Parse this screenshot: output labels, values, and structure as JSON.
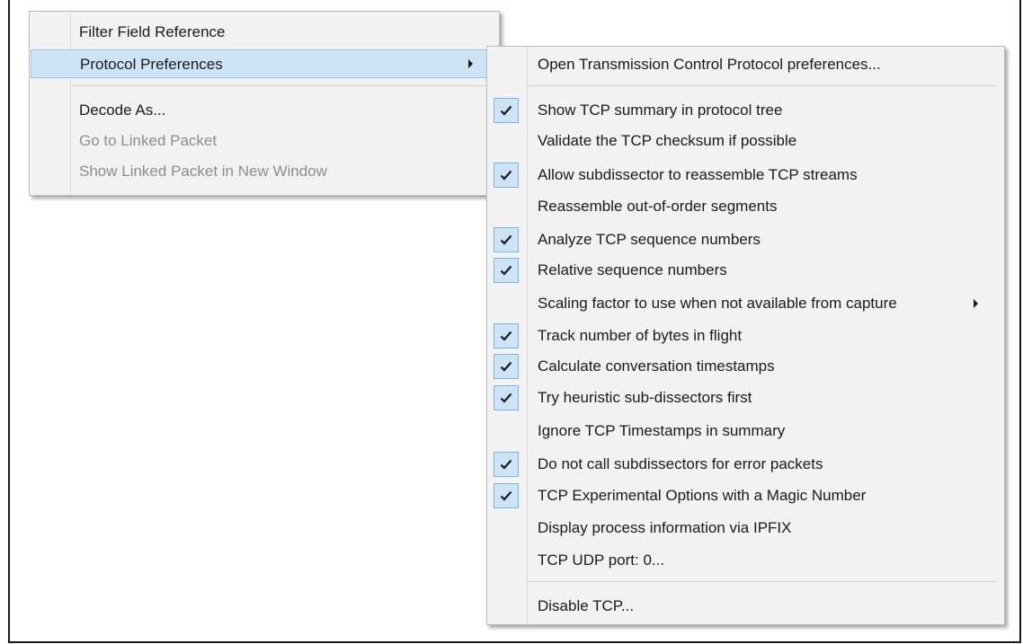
{
  "left_menu": {
    "items": [
      {
        "label": "Filter Field Reference",
        "enabled": true,
        "highlighted": false,
        "submenu": false
      },
      {
        "label": "Protocol Preferences",
        "enabled": true,
        "highlighted": true,
        "submenu": true
      },
      {
        "label": "Decode As...",
        "enabled": true,
        "highlighted": false,
        "submenu": false
      },
      {
        "label": "Go to Linked Packet",
        "enabled": false,
        "highlighted": false,
        "submenu": false
      },
      {
        "label": "Show Linked Packet in New Window",
        "enabled": false,
        "highlighted": false,
        "submenu": false
      }
    ]
  },
  "submenu": {
    "items": [
      {
        "label": "Open Transmission Control Protocol preferences...",
        "checked": false,
        "submenu": false
      },
      {
        "label": "Show TCP summary in protocol tree",
        "checked": true,
        "submenu": false
      },
      {
        "label": "Validate the TCP checksum if possible",
        "checked": false,
        "submenu": false
      },
      {
        "label": "Allow subdissector to reassemble TCP streams",
        "checked": true,
        "submenu": false
      },
      {
        "label": "Reassemble out-of-order segments",
        "checked": false,
        "submenu": false
      },
      {
        "label": "Analyze TCP sequence numbers",
        "checked": true,
        "submenu": false
      },
      {
        "label": "Relative sequence numbers",
        "checked": true,
        "submenu": false
      },
      {
        "label": "Scaling factor to use when not available from capture",
        "checked": false,
        "submenu": true
      },
      {
        "label": "Track number of bytes in flight",
        "checked": true,
        "submenu": false
      },
      {
        "label": "Calculate conversation timestamps",
        "checked": true,
        "submenu": false
      },
      {
        "label": "Try heuristic sub-dissectors first",
        "checked": true,
        "submenu": false
      },
      {
        "label": "Ignore TCP Timestamps in summary",
        "checked": false,
        "submenu": false
      },
      {
        "label": "Do not call subdissectors for error packets",
        "checked": true,
        "submenu": false
      },
      {
        "label": "TCP Experimental Options with a Magic Number",
        "checked": true,
        "submenu": false
      },
      {
        "label": "Display process information via IPFIX",
        "checked": false,
        "submenu": false
      },
      {
        "label": "TCP UDP port: 0...",
        "checked": false,
        "submenu": false
      },
      {
        "label": "Disable TCP...",
        "checked": false,
        "submenu": false
      }
    ]
  },
  "colors": {
    "menu_bg": "#f2f2f2",
    "highlight_bg": "#cde4f7",
    "highlight_border": "#99c7ec",
    "disabled_text": "#8d8d8d",
    "check_bg": "#cde4f7"
  },
  "icons": {
    "submenu_arrow": "chevron-right-icon",
    "check": "checkmark-icon"
  }
}
